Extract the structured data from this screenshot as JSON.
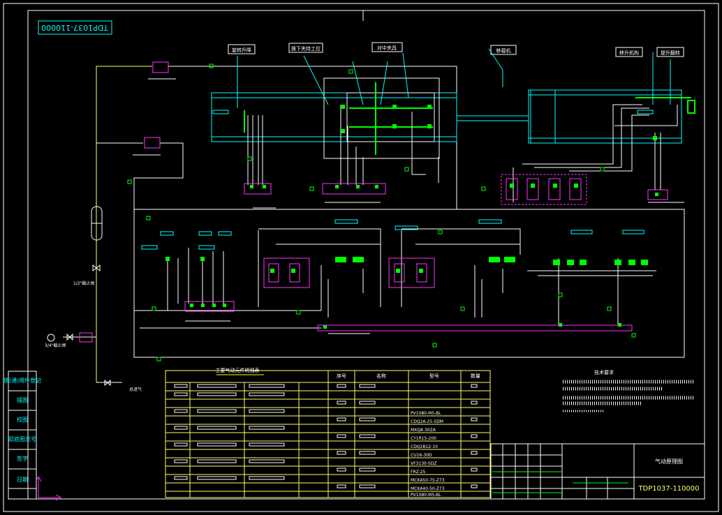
{
  "drawing": {
    "number": "TDP1037-110000",
    "number_mirrored": "TDP1037-110000",
    "title": "气动原理图"
  },
  "stations": {
    "s1": "旋转升降",
    "s2": "换下夹持工位",
    "s3": "对中夹具",
    "s4": "移载机",
    "s5": "移升机构",
    "s6": "提升翻转"
  },
  "valves": {
    "v1": "1/2\"截止阀",
    "v2": "3/4\"截止阀",
    "drain": "总进气"
  },
  "table": {
    "title": "主要气动元件明细表",
    "headers": [
      "序号",
      "名称",
      "型号",
      "数量"
    ],
    "models": [
      "PV1080-M5-BL",
      "CDQ2A-25-5DM",
      "MXQ8-30ZA",
      "CY1R15-200",
      "CDQ2B12-10",
      "CU16-30D",
      "VF3130-5DZ",
      "FRZ-25",
      "MCKA50-75-Z73",
      "MCKA40-50-Z73",
      "PV1080-M5-BL",
      "PV1080-M5-BL",
      "PV1080-M5-BL"
    ]
  },
  "tech": {
    "title": "技术要求"
  },
  "left_strip": [
    "借(通)用件登记",
    "描图",
    "校图",
    "旧底图总号",
    "签字",
    "日期"
  ]
}
